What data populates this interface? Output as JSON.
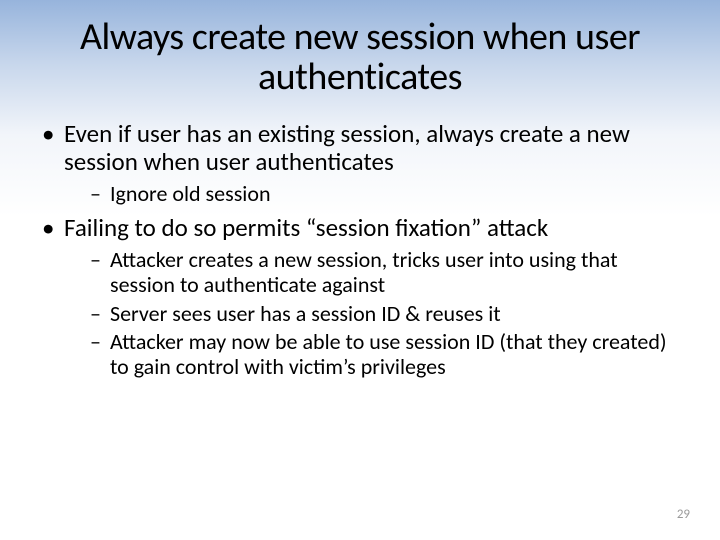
{
  "title": "Always create new session when user authenticates",
  "bullets": [
    {
      "text": "Even if user has an existing session, always create a new session when user authenticates",
      "sub": [
        "Ignore old session"
      ]
    },
    {
      "text": "Failing to do so permits “session fixation” attack",
      "sub": [
        "Attacker creates a new session, tricks user into using that session to authenticate against",
        "Server sees user has a session ID & reuses it",
        "Attacker may now be able to use session ID (that they created) to gain control with victim’s privileges"
      ]
    }
  ],
  "page_number": "29"
}
